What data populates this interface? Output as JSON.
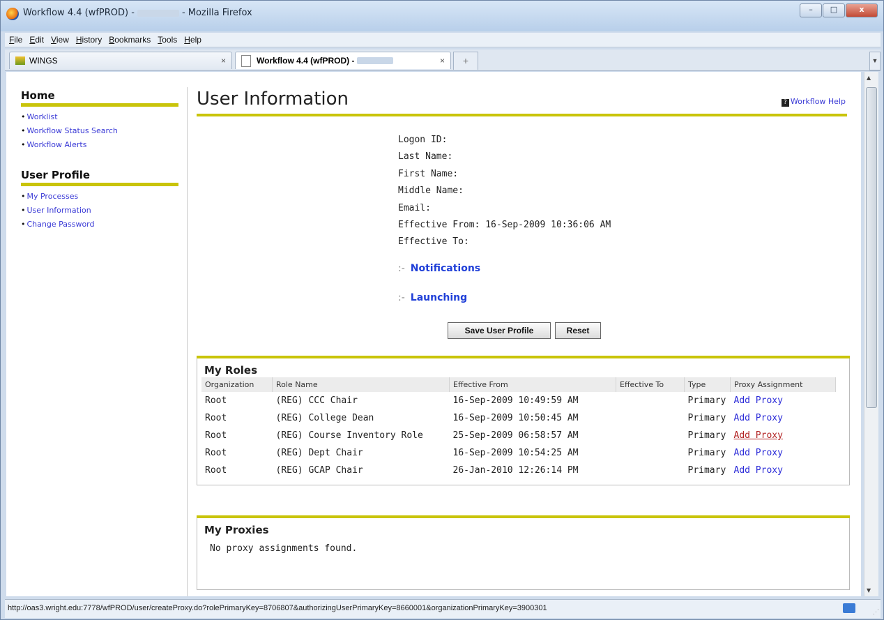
{
  "window": {
    "title_prefix": "Workflow 4.4 (wfPROD) -",
    "title_suffix": "- Mozilla Firefox",
    "minimize": "–",
    "maximize": "□",
    "close": "x"
  },
  "menu": [
    "File",
    "Edit",
    "View",
    "History",
    "Bookmarks",
    "Tools",
    "Help"
  ],
  "tabs": [
    {
      "label": "WINGS",
      "close": "×"
    },
    {
      "label": "Workflow 4.4 (wfPROD) -",
      "close": "×"
    }
  ],
  "new_tab": "+",
  "status_url": "http://oas3.wright.edu:7778/wfPROD/user/createProxy.do?rolePrimaryKey=8706807&authorizingUserPrimaryKey=8660001&organizationPrimaryKey=3900301",
  "sidebar": {
    "home_heading": "Home",
    "home_links": [
      "Worklist",
      "Workflow Status Search",
      "Workflow Alerts"
    ],
    "profile_heading": "User Profile",
    "profile_links": [
      "My Processes",
      "User Information",
      "Change Password"
    ]
  },
  "page": {
    "title": "User Information",
    "help_link": "Workflow Help",
    "info": [
      "Logon ID:",
      "Last Name:",
      "First Name:",
      "Middle Name:",
      "Email:",
      "Effective From: 16-Sep-2009 10:36:06 AM",
      "Effective To:"
    ],
    "notifications": "Notifications",
    "launching": "Launching",
    "save_button": "Save User Profile",
    "reset_button": "Reset"
  },
  "roles": {
    "heading": "My Roles",
    "columns": [
      "Organization",
      "Role Name",
      "Effective From",
      "Effective To",
      "Type",
      "Proxy Assignment"
    ],
    "rows": [
      {
        "org": "Root",
        "role": "(REG) CCC Chair",
        "from": "16-Sep-2009 10:49:59 AM",
        "to": "",
        "type": "Primary",
        "proxy": "Add Proxy"
      },
      {
        "org": "Root",
        "role": "(REG) College Dean",
        "from": "16-Sep-2009 10:50:45 AM",
        "to": "",
        "type": "Primary",
        "proxy": "Add Proxy"
      },
      {
        "org": "Root",
        "role": "(REG) Course Inventory Role",
        "from": "25-Sep-2009 06:58:57 AM",
        "to": "",
        "type": "Primary",
        "proxy": "Add Proxy"
      },
      {
        "org": "Root",
        "role": "(REG) Dept Chair",
        "from": "16-Sep-2009 10:54:25 AM",
        "to": "",
        "type": "Primary",
        "proxy": "Add Proxy"
      },
      {
        "org": "Root",
        "role": "(REG) GCAP Chair",
        "from": "26-Jan-2010 12:26:14 PM",
        "to": "",
        "type": "Primary",
        "proxy": "Add Proxy"
      }
    ]
  },
  "proxies": {
    "heading": "My Proxies",
    "empty_text": "No proxy assignments found."
  },
  "colors": {
    "accent_rule": "#c9c40a",
    "link": "#3a3ad6",
    "visited_link": "#b22222"
  }
}
